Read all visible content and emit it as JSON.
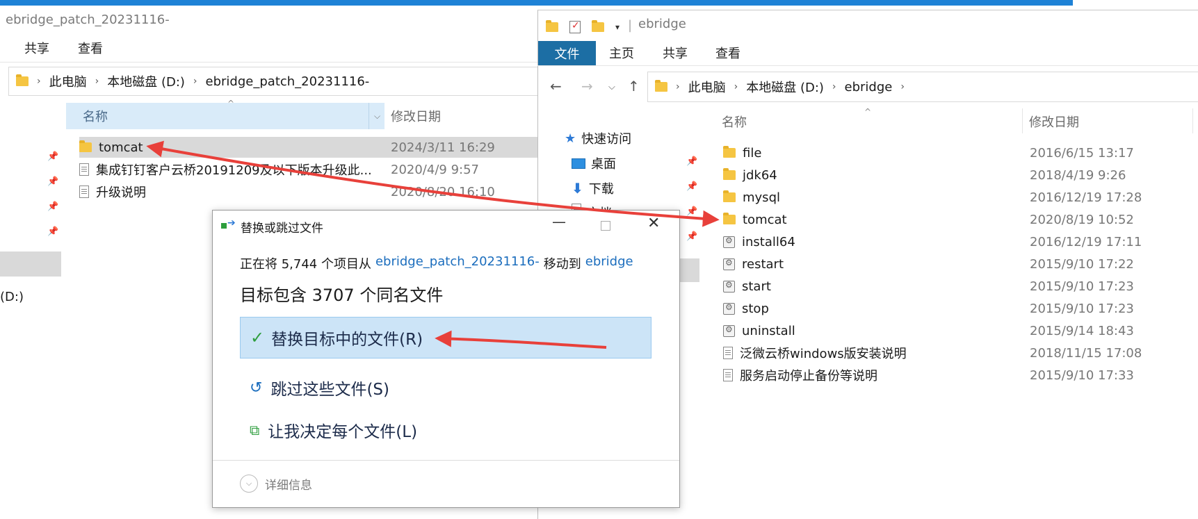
{
  "left_window": {
    "title": "ebridge_patch_20231116-",
    "ribbon": {
      "share": "共享",
      "view": "查看"
    },
    "breadcrumb": [
      "此电脑",
      "本地磁盘 (D:)",
      "ebridge_patch_20231116-"
    ],
    "drive_label": "(D:)",
    "columns": {
      "name": "名称",
      "date": "修改日期"
    },
    "rows": [
      {
        "name": "tomcat",
        "date": "2024/3/11 16:29",
        "icon": "folder-icon"
      },
      {
        "name": "集成钉钉客户云桥20191209及以下版本升级此...",
        "date": "2020/4/9 9:57",
        "icon": "file-icon"
      },
      {
        "name": "升级说明",
        "date": "2020/8/20 16:10",
        "icon": "file-icon"
      }
    ]
  },
  "right_window": {
    "title": "ebridge",
    "ribbon": {
      "file": "文件",
      "home": "主页",
      "share": "共享",
      "view": "查看"
    },
    "breadcrumb": [
      "此电脑",
      "本地磁盘 (D:)",
      "ebridge"
    ],
    "nav": {
      "quick_access": "快速访问",
      "desktop": "桌面",
      "downloads": "下载",
      "docs": "文档"
    },
    "columns": {
      "name": "名称",
      "date": "修改日期"
    },
    "rows": [
      {
        "name": "file",
        "date": "2016/6/15 13:17",
        "icon": "folder-icon"
      },
      {
        "name": "jdk64",
        "date": "2018/4/19 9:26",
        "icon": "folder-icon"
      },
      {
        "name": "mysql",
        "date": "2016/12/19 17:28",
        "icon": "folder-icon"
      },
      {
        "name": "tomcat",
        "date": "2020/8/19 10:52",
        "icon": "folder-icon"
      },
      {
        "name": "install64",
        "date": "2016/12/19 17:11",
        "icon": "bat-icon"
      },
      {
        "name": "restart",
        "date": "2015/9/10 17:22",
        "icon": "bat-icon"
      },
      {
        "name": "start",
        "date": "2015/9/10 17:23",
        "icon": "bat-icon"
      },
      {
        "name": "stop",
        "date": "2015/9/10 17:23",
        "icon": "bat-icon"
      },
      {
        "name": "uninstall",
        "date": "2015/9/14 18:43",
        "icon": "bat-icon"
      },
      {
        "name": "泛微云桥windows版安装说明",
        "date": "2018/11/15 17:08",
        "icon": "file-icon"
      },
      {
        "name": "服务启动停止备份等说明",
        "date": "2015/9/10 17:33",
        "icon": "file-icon"
      }
    ]
  },
  "dialog": {
    "title": "替换或跳过文件",
    "line1_prefix": "正在将 5,744 个项目从",
    "line1_source": "ebridge_patch_20231116-",
    "line1_middle": "移动到",
    "line1_target": "ebridge",
    "heading": "目标包含 3707 个同名文件",
    "option_replace": "替换目标中的文件(R)",
    "option_skip": "跳过这些文件(S)",
    "option_decide": "让我决定每个文件(L)",
    "details": "详细信息"
  },
  "colors": {
    "accent": "#1e82d6",
    "file_tab": "#1c6ea4",
    "selection": "#cce4f7",
    "annotation_arrow": "#e8403a"
  }
}
